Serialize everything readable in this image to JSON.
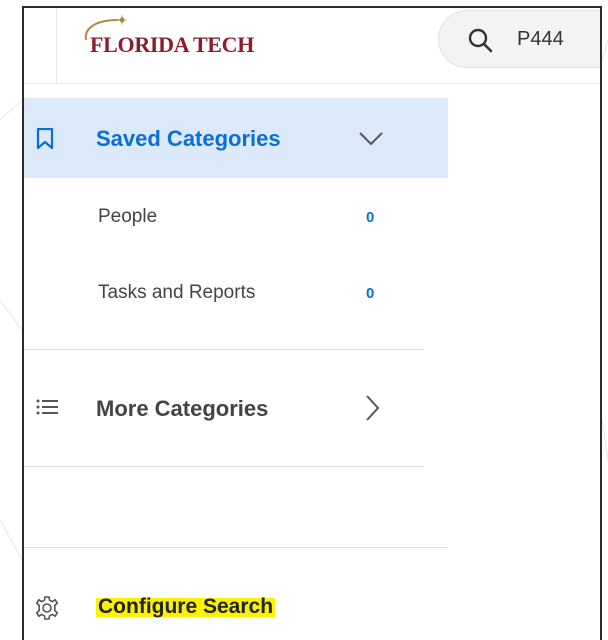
{
  "brand": {
    "logo_text": "FLORIDA TECH",
    "logo_color": "#8a1e2a"
  },
  "search": {
    "value": "P444",
    "icon": "search-icon"
  },
  "sidebar": {
    "saved": {
      "label": "Saved Categories",
      "icon": "bookmark-icon",
      "expand_icon": "chevron-down-icon",
      "expanded": true
    },
    "saved_items": [
      {
        "label": "People",
        "count": "0"
      },
      {
        "label": "Tasks and Reports",
        "count": "0"
      }
    ],
    "more": {
      "label": "More Categories",
      "icon": "list-icon",
      "expand_icon": "chevron-right-icon"
    },
    "configure": {
      "label": "Configure Search",
      "icon": "gear-icon",
      "highlight": "#fbf200"
    }
  },
  "colors": {
    "accent": "#0a6fd6",
    "selected_bg": "#dbe9fb",
    "text": "#444444"
  }
}
